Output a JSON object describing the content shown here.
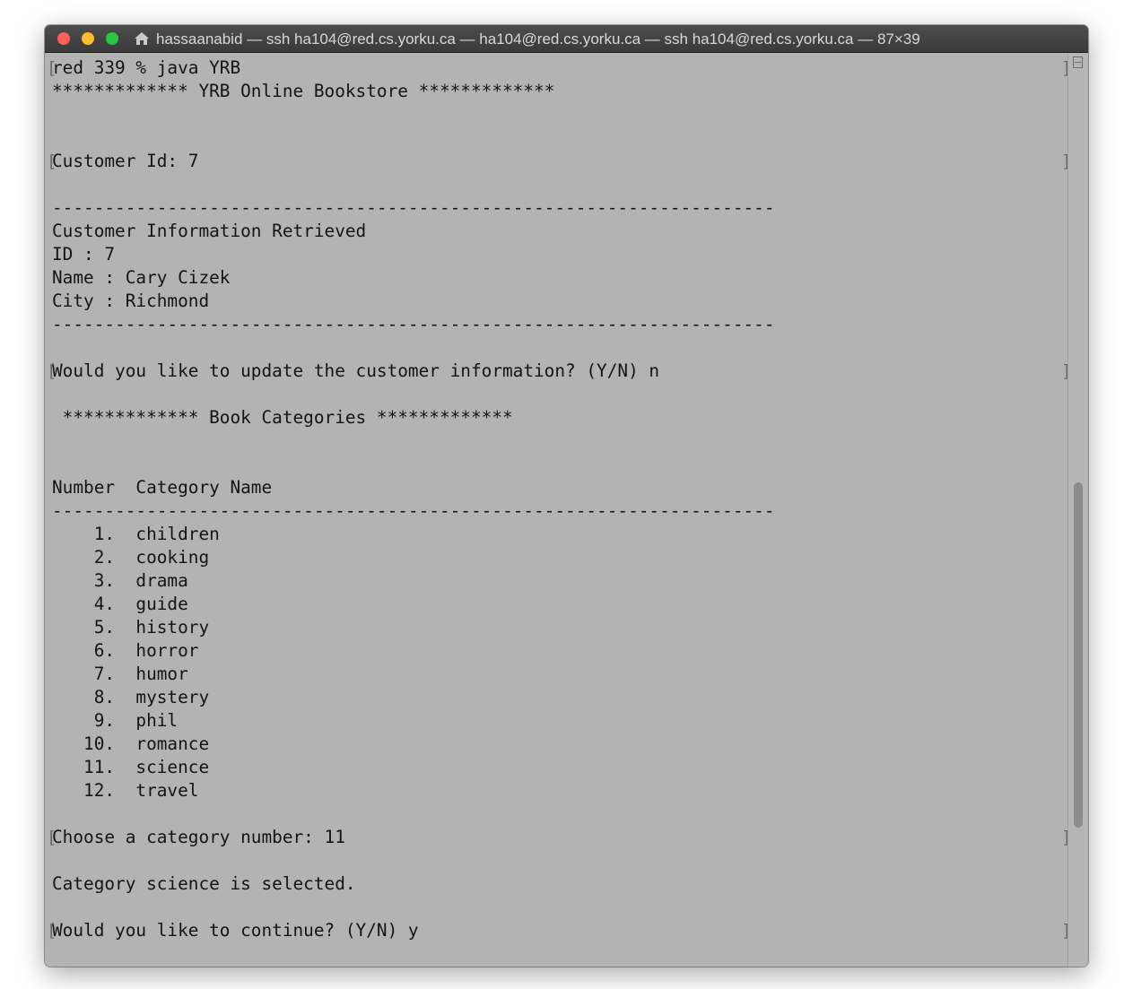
{
  "window": {
    "title": "hassaanabid — ssh ha104@red.cs.yorku.ca — ha104@red.cs.yorku.ca — ssh ha104@red.cs.yorku.ca — 87×39"
  },
  "terminal": {
    "lines": [
      "red 339 % java YRB",
      "************* YRB Online Bookstore *************",
      "",
      "",
      "Customer Id: 7",
      "",
      "---------------------------------------------------------------------",
      "Customer Information Retrieved",
      "ID : 7",
      "Name : Cary Cizek",
      "City : Richmond",
      "---------------------------------------------------------------------",
      "",
      "Would you like to update the customer information? (Y/N) n",
      "",
      " ************* Book Categories *************",
      "",
      "",
      "Number  Category Name",
      "---------------------------------------------------------------------",
      "    1.  children",
      "    2.  cooking",
      "    3.  drama",
      "    4.  guide",
      "    5.  history",
      "    6.  horror",
      "    7.  humor",
      "    8.  mystery",
      "    9.  phil",
      "   10.  romance",
      "   11.  science",
      "   12.  travel",
      "",
      "Choose a category number: 11",
      "",
      "Category science is selected.",
      "",
      "Would you like to continue? (Y/N) y"
    ]
  },
  "prompt_marks": {
    "left": "[",
    "right": "]"
  }
}
